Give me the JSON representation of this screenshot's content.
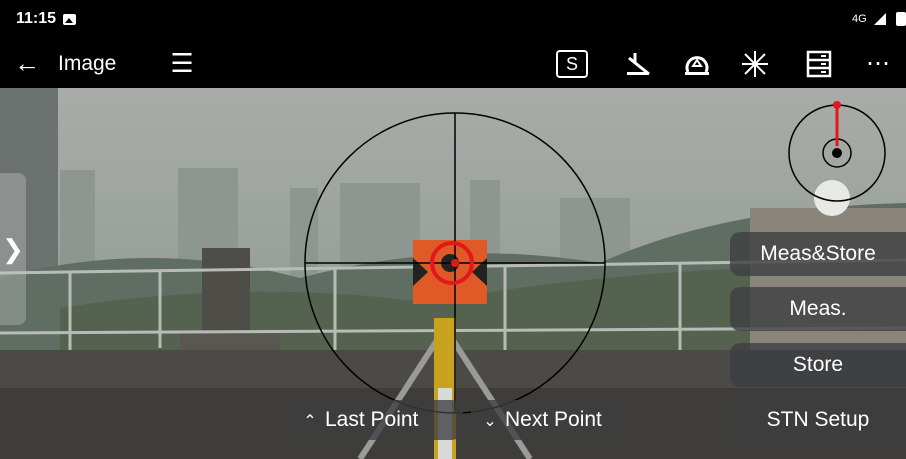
{
  "status_bar": {
    "time": "11:15",
    "network": "4G"
  },
  "app_bar": {
    "title": "Image",
    "icons": [
      "back-arrow-icon",
      "menu-icon",
      "s-mode-icon",
      "laser-off-icon",
      "prism-icon",
      "laser-pointer-icon",
      "storage-icon",
      "more-icon"
    ],
    "s_label": "S",
    "more_label": "⋯"
  },
  "side_tab": {
    "label": "❯"
  },
  "actions": {
    "meas_store": "Meas&Store",
    "meas": "Meas.",
    "store": "Store",
    "stn_setup": "STN Setup"
  },
  "point_nav": {
    "last": "Last Point",
    "next": "Next Point"
  },
  "colors": {
    "reticle": "#000000",
    "target": "#e3161b",
    "indicator": "#e3161b"
  }
}
